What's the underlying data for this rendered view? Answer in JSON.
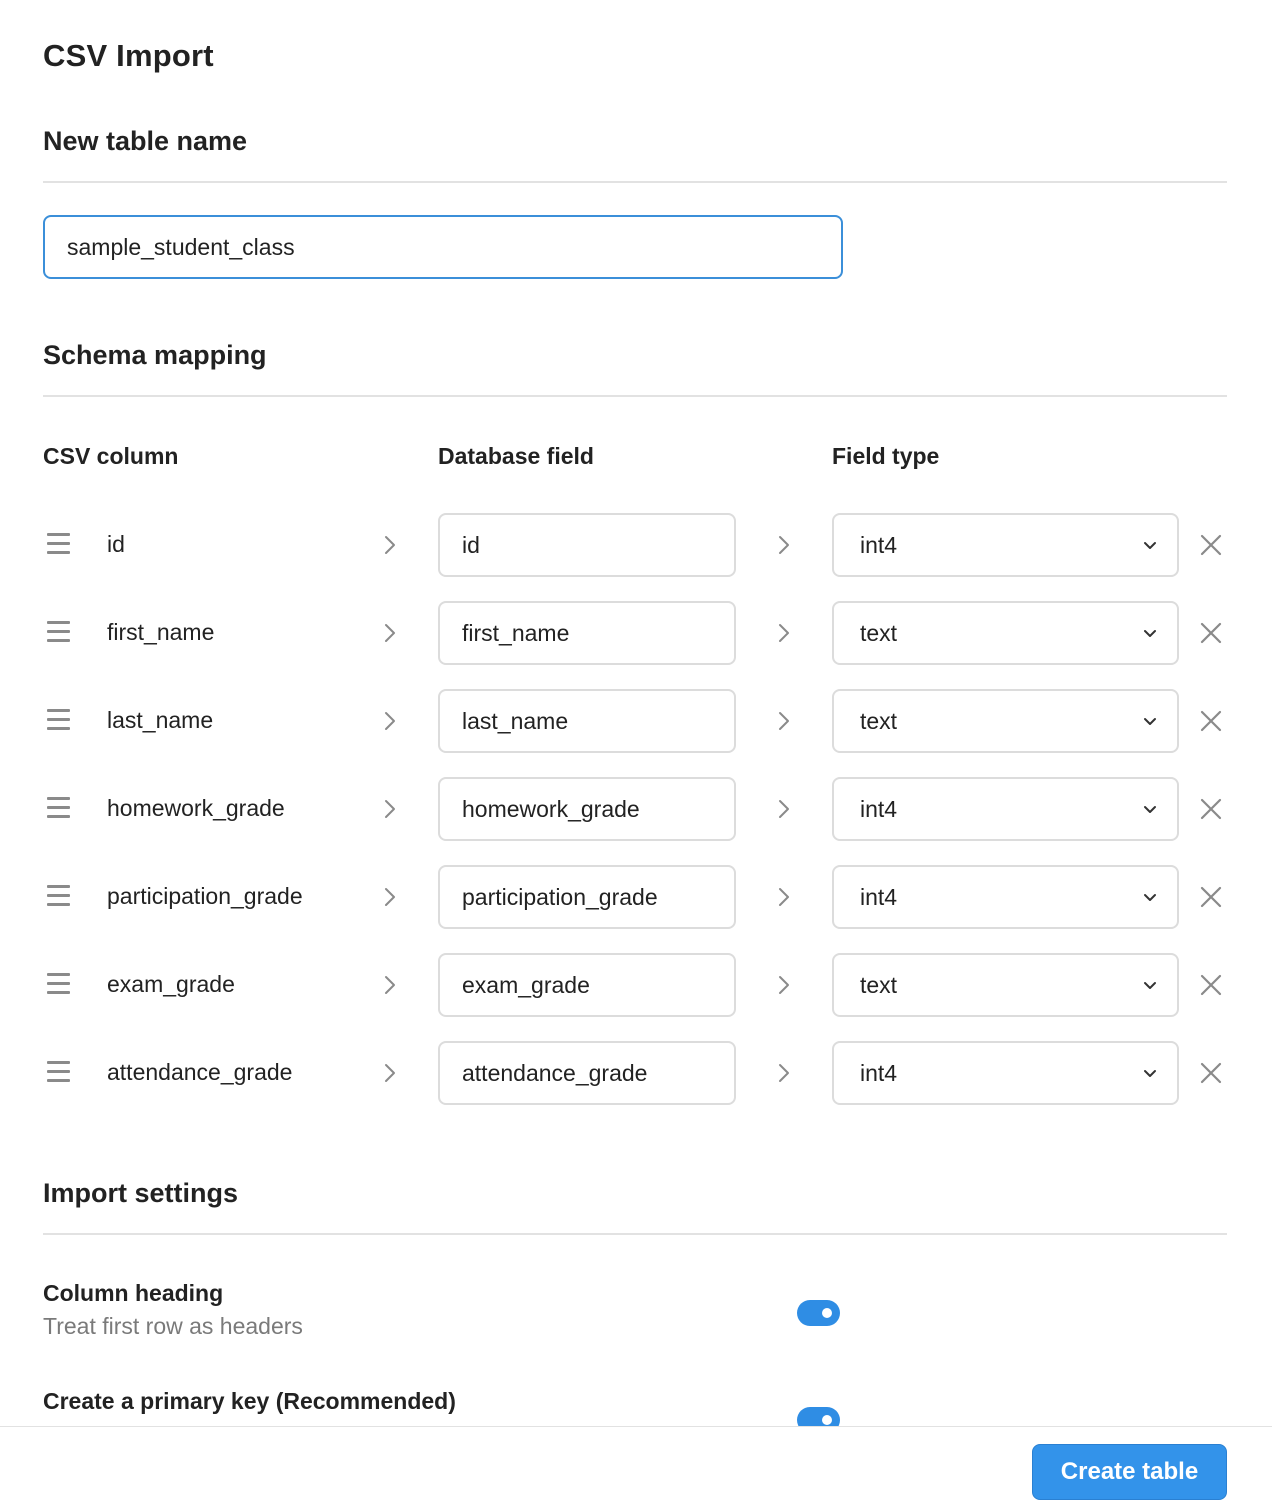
{
  "page": {
    "title": "CSV Import"
  },
  "table_name": {
    "heading": "New table name",
    "value": "sample_student_class"
  },
  "schema": {
    "heading": "Schema mapping",
    "headers": {
      "csv": "CSV column",
      "db": "Database field",
      "type": "Field type"
    },
    "rows": [
      {
        "csv": "id",
        "field": "id",
        "type": "int4"
      },
      {
        "csv": "first_name",
        "field": "first_name",
        "type": "text"
      },
      {
        "csv": "last_name",
        "field": "last_name",
        "type": "text"
      },
      {
        "csv": "homework_grade",
        "field": "homework_grade",
        "type": "int4"
      },
      {
        "csv": "participation_grade",
        "field": "participation_grade",
        "type": "int4"
      },
      {
        "csv": "exam_grade",
        "field": "exam_grade",
        "type": "text"
      },
      {
        "csv": "attendance_grade",
        "field": "attendance_grade",
        "type": "int4"
      }
    ]
  },
  "import_settings": {
    "heading": "Import settings",
    "column_heading": {
      "title": "Column heading",
      "desc": "Treat first row as headers",
      "enabled": true
    },
    "primary_key": {
      "title": "Create a primary key (Recommended)",
      "enabled": true
    }
  },
  "footer": {
    "create_label": "Create table"
  },
  "colors": {
    "accent": "#3393ea",
    "input_focus_border": "#3b8fd9",
    "toggle_on": "#2f8de4"
  }
}
